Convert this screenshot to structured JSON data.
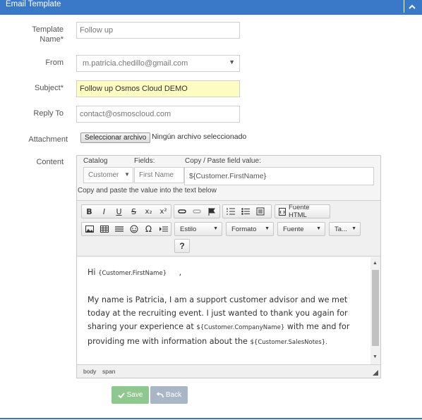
{
  "window": {
    "title": "Email Template"
  },
  "form": {
    "template_name_label": "Template Name*",
    "template_name_value": "Follow up",
    "from_label": "From",
    "from_value": "m.patricia.chedillo@gmail.com",
    "subject_label": "Subject*",
    "subject_value": "Follow up Osmos Cloud DEMO",
    "reply_to_label": "Reply To",
    "reply_to_value": "contact@osmoscloud.com",
    "attachment_label": "Attachment",
    "attachment_button": "Seleccionar archivo",
    "attachment_status": "Ningún archivo seleccionado",
    "content_label": "Content"
  },
  "fields_panel": {
    "catalog_label": "Catalog",
    "catalog_value": "Customer",
    "fields_label": "Fields:",
    "fields_value": "First Name",
    "copy_label": "Copy / Paste field value:",
    "copy_value": "${Customer.FirstName}",
    "hint": "Copy and paste the value into the text below"
  },
  "toolbar": {
    "bold": "B",
    "italic": "I",
    "underline": "U",
    "strike": "S",
    "subscript": "x₂",
    "superscript": "x²",
    "source_label": "Fuente HTML",
    "omega": "Ω",
    "style_label": "Estilo",
    "format_label": "Formato",
    "font_label": "Fuente",
    "size_label": "Ta...",
    "help": "?"
  },
  "editor": {
    "hi": "Hi",
    "greeting_var": "{Customer.FirstName}",
    "comma": ",",
    "p1_a": "My name is Patricia, I am a support customer advisor and we met today at the recruiting event. I just wanted to thank you again for sharing your experience at",
    "company_var": "${Customer.CompanyName}",
    "p1_b": "with me and for providing me with information about the",
    "notes_var": "${Customer.SalesNotes}",
    "p1_end": "."
  },
  "statusbar": {
    "path1": "body",
    "path2": "span"
  },
  "actions": {
    "save_label": "Save",
    "back_label": "Back"
  },
  "colors": {
    "header": "#3a79c8",
    "save": "#8fc88f",
    "back": "#a9b6c6",
    "subject_bg": "#fdfdc2"
  }
}
